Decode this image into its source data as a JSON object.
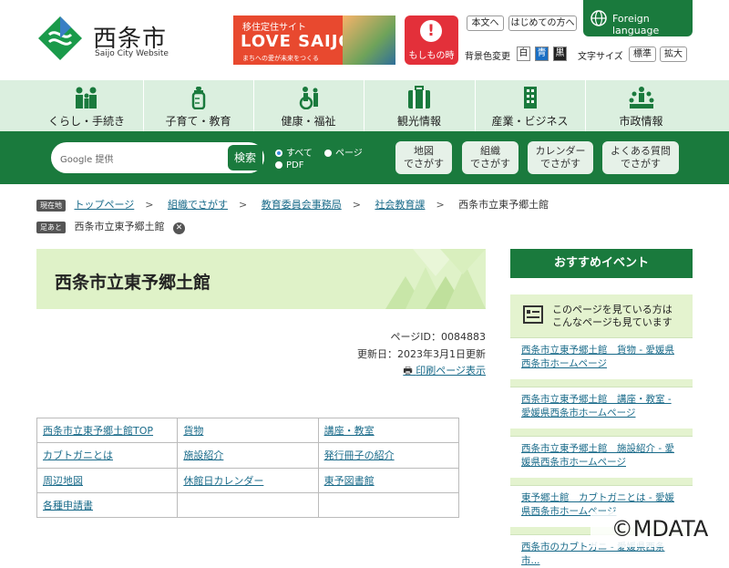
{
  "header": {
    "logo_title": "西条市",
    "logo_sub": "Saijo City Website",
    "banner": {
      "top": "移住定住サイト",
      "main": "LOVE SAIJO",
      "sub": "まちへの愛が未来をつくる"
    },
    "emergency_label": "もしもの時",
    "buttons": {
      "text_only": "本文へ",
      "first_time": "はじめての方へ"
    },
    "foreign_language": "Foreign language",
    "bg_color_label": "背景色変更",
    "bg_options": [
      "白",
      "青",
      "黒"
    ],
    "font_size_label": "文字サイズ",
    "font_options": [
      "標準",
      "拡大"
    ]
  },
  "global_nav": [
    {
      "label": "くらし・手続き",
      "icon": "family-icon"
    },
    {
      "label": "子育て・教育",
      "icon": "baby-bottle-icon"
    },
    {
      "label": "健康・福祉",
      "icon": "wheelchair-icon"
    },
    {
      "label": "観光情報",
      "icon": "suitcase-icon"
    },
    {
      "label": "産業・ビジネス",
      "icon": "building-icon"
    },
    {
      "label": "市政情報",
      "icon": "council-icon"
    }
  ],
  "search": {
    "google_label": "Google 提供",
    "button": "検索",
    "options": [
      "すべて",
      "ページ",
      "PDF"
    ],
    "finders": [
      [
        "地図",
        "でさがす"
      ],
      [
        "組織",
        "でさがす"
      ],
      [
        "カレンダー",
        "でさがす"
      ],
      [
        "よくある質問",
        "でさがす"
      ]
    ]
  },
  "breadcrumb": {
    "current_tag": "現在地",
    "items": [
      "トップページ",
      "組織でさがす",
      "教育委員会事務局",
      "社会教育課",
      "西条市立東予郷土館"
    ],
    "trail_tag": "足あと",
    "trail_item": "西条市立東予郷土館"
  },
  "page": {
    "title": "西条市立東予郷土館",
    "page_id": "ページID：0084883",
    "updated": "更新日：2023年3月1日更新",
    "print": "印刷ページ表示"
  },
  "link_table": [
    [
      "西条市立東予郷土館TOP",
      "貨物",
      "講座・教室"
    ],
    [
      "カブトガニとは",
      "施設紹介",
      "発行冊子の紹介"
    ],
    [
      "周辺地図",
      "休館日カレンダー",
      "東予図書館"
    ],
    [
      "各種申請書",
      "",
      ""
    ]
  ],
  "sidebar": {
    "heading": "おすすめイベント",
    "box_title": [
      "このページを見ている方は",
      "こんなページも見ています"
    ],
    "links": [
      "西条市立東予郷土館　貨物 - 愛媛県西条市ホームページ",
      "西条市立東予郷土館　講座・教室 - 愛媛県西条市ホームページ",
      "西条市立東予郷土館　施設紹介 - 愛媛県西条市ホームページ",
      "東予郷土館　カブトガニとは - 愛媛県西条市ホームページ",
      "西条市のカブトガニ - 愛媛県西条市..."
    ]
  },
  "watermark": "©MDATA",
  "colors": {
    "brand_green": "#1a7a3d",
    "light_green": "#dbefdf",
    "header_band": "#dff2c8",
    "emergency_red": "#e3303a",
    "link": "#1a6b8a"
  }
}
